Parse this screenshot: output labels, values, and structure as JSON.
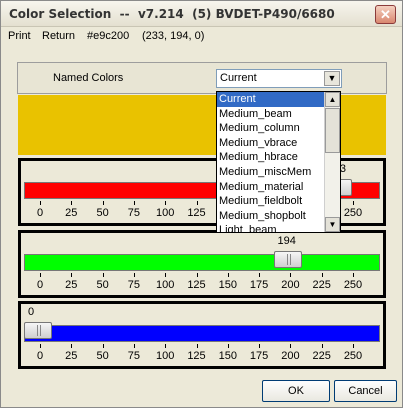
{
  "window": {
    "title": "Color Selection  --  v7.214  (5) BVDET-P490/6680",
    "close_label": "✕"
  },
  "menu": {
    "print": "Print",
    "return": "Return",
    "hex": "#e9c200",
    "rgb": "(233, 194, 0)"
  },
  "named_colors": {
    "label": "Named Colors",
    "selected": "Current",
    "options": [
      "Current",
      "Medium_beam",
      "Medium_column",
      "Medium_vbrace",
      "Medium_hbrace",
      "Medium_miscMem",
      "Medium_material",
      "Medium_fieldbolt",
      "Medium_shopbolt",
      "Light_beam"
    ]
  },
  "swatch_color": "#e9c200",
  "sliders": {
    "red": {
      "value": "233",
      "fill": "#ff0000",
      "max": 255
    },
    "green": {
      "value": "194",
      "fill": "#00ff00",
      "max": 255
    },
    "blue": {
      "value": "0",
      "fill": "#0000ff",
      "max": 255
    }
  },
  "tick_labels": [
    "0",
    "25",
    "50",
    "75",
    "100",
    "125",
    "150",
    "175",
    "200",
    "225",
    "250"
  ],
  "buttons": {
    "ok": "OK",
    "cancel": "Cancel"
  }
}
